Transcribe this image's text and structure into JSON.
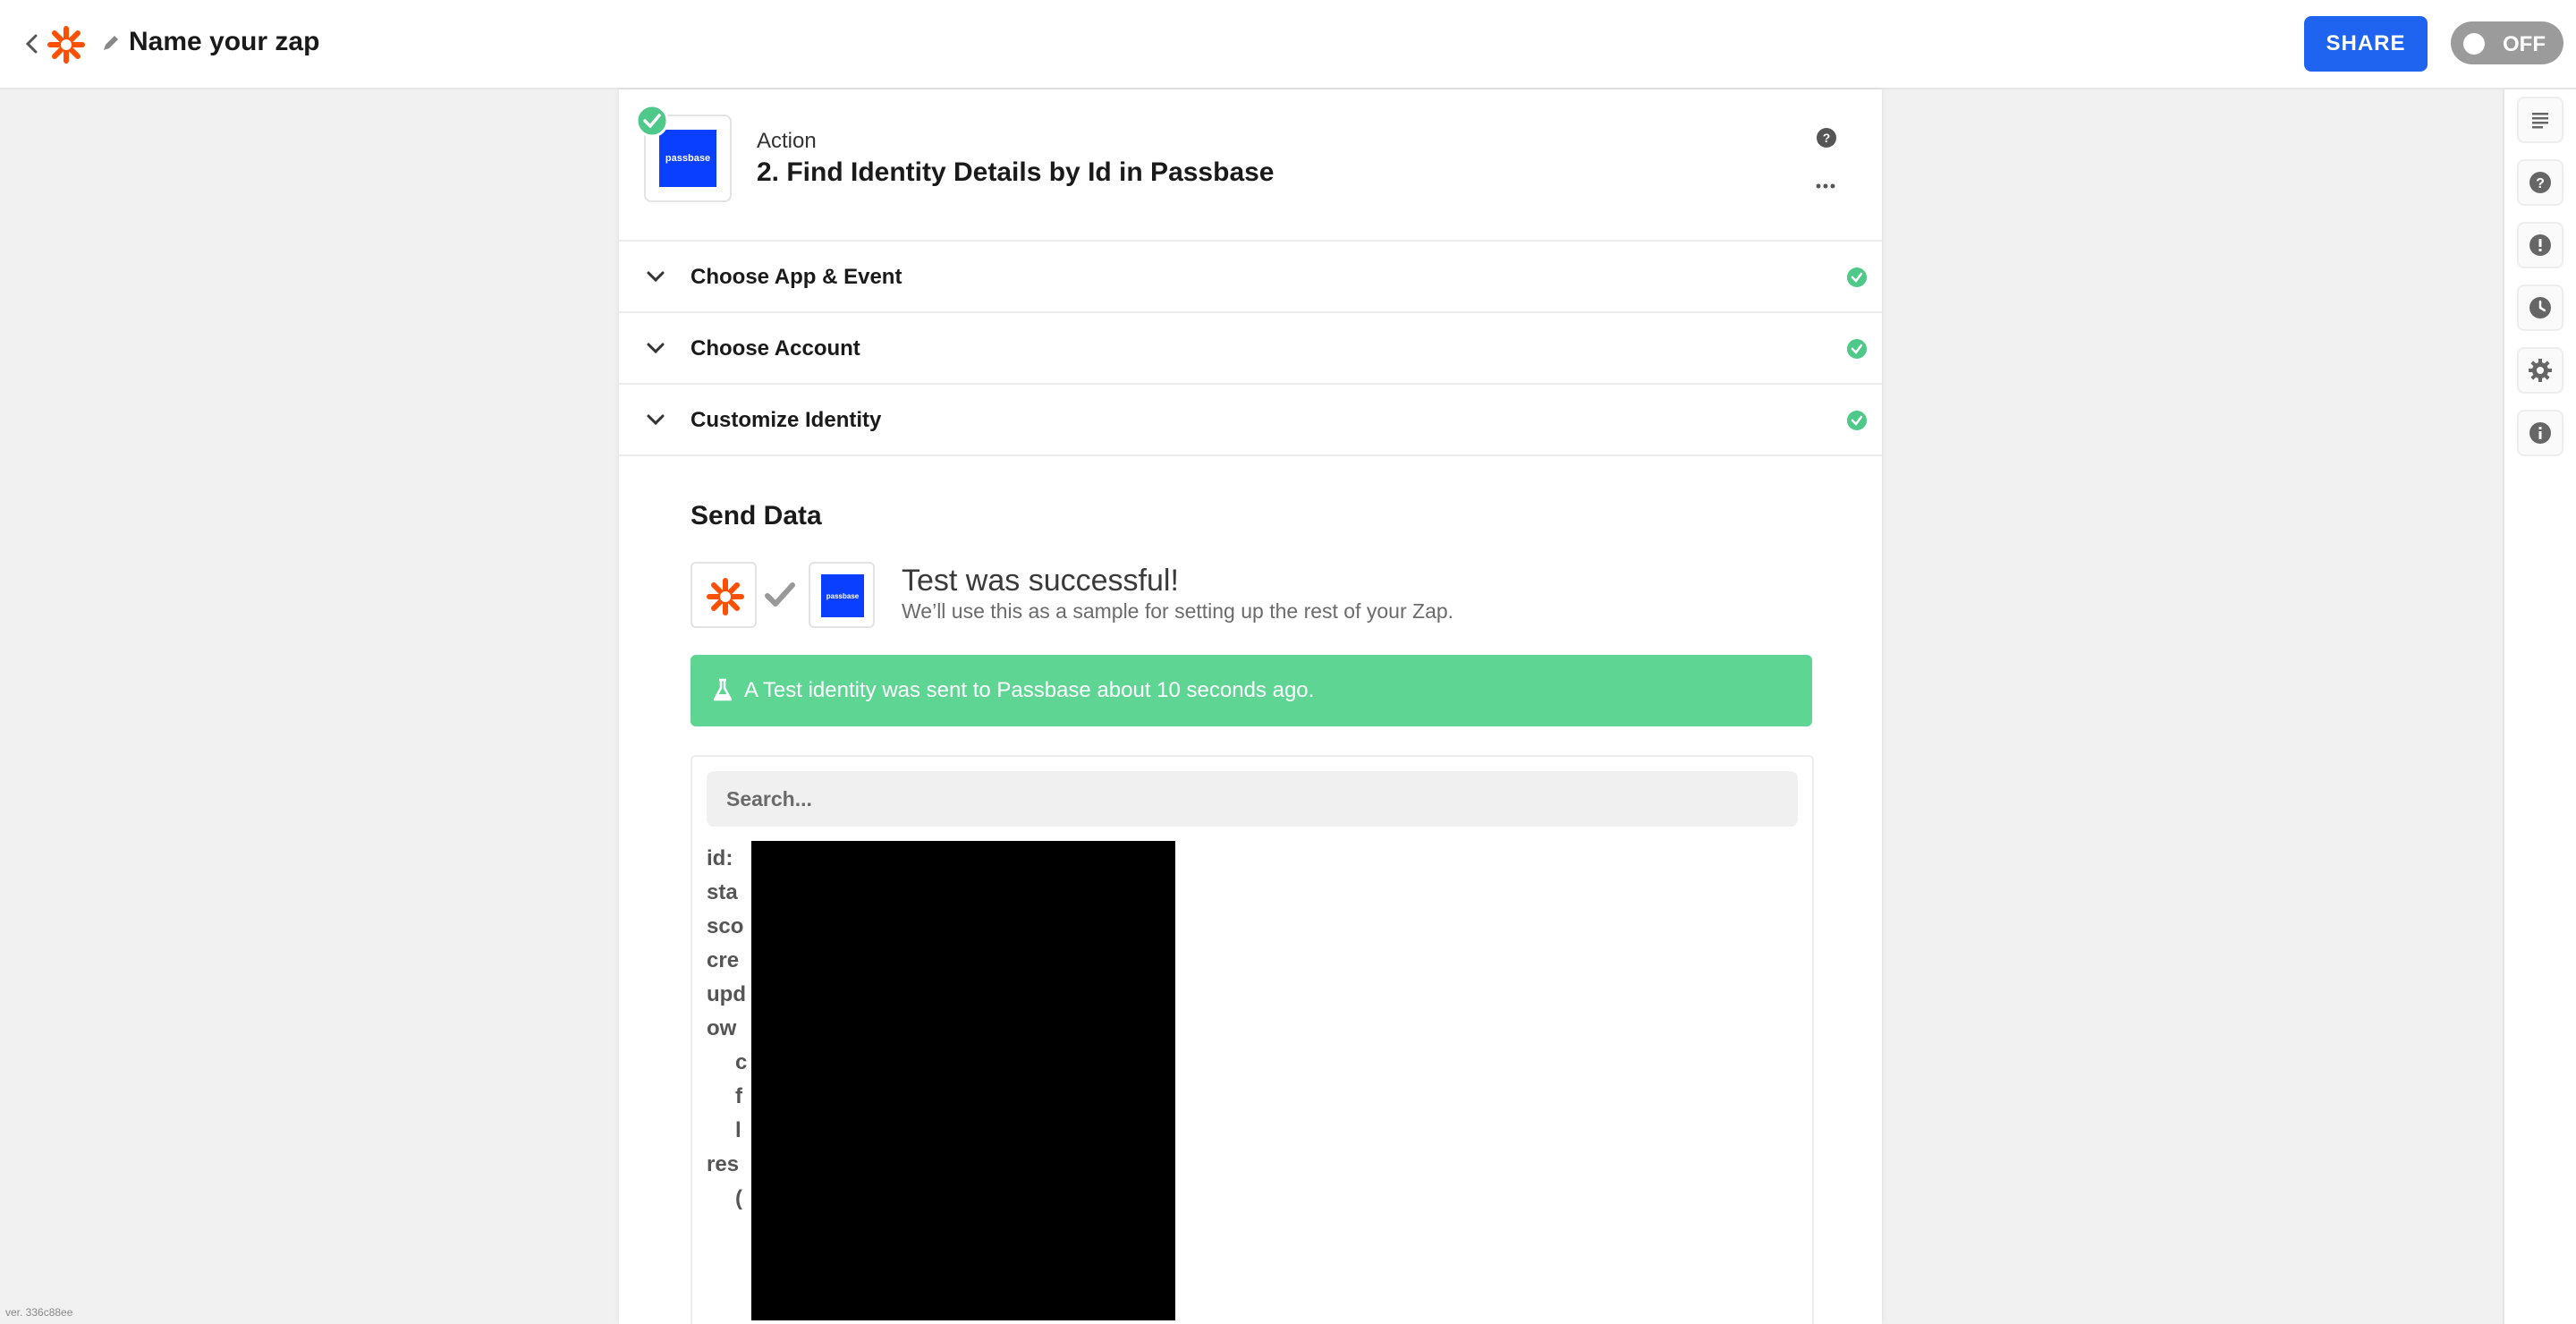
{
  "topbar": {
    "zap_name": "Name your zap",
    "share_label": "SHARE",
    "toggle_label": "OFF",
    "brand_color": "#ff4f00",
    "share_color": "#1e64f0"
  },
  "step": {
    "type_label": "Action",
    "title": "2. Find Identity Details by Id in Passbase",
    "app_logo_text": "passbase"
  },
  "sections": [
    {
      "label": "Choose App & Event"
    },
    {
      "label": "Choose Account"
    },
    {
      "label": "Customize Identity"
    }
  ],
  "send_data": {
    "title": "Send Data",
    "success_title": "Test was successful!",
    "success_subtitle": "We’ll use this as a sample for setting up the rest of your Zap.",
    "banner_text": "A Test identity was sent to Passbase about 10 seconds ago.",
    "banner_color": "#5ed592",
    "search_placeholder": "Search..."
  },
  "fields": [
    {
      "key": "id:"
    },
    {
      "key": "sta"
    },
    {
      "key": "sco"
    },
    {
      "key": "cre"
    },
    {
      "key": "upd"
    },
    {
      "key": "ow"
    },
    {
      "key": "c"
    },
    {
      "key": "f"
    },
    {
      "key": "l"
    },
    {
      "key": "res"
    },
    {
      "key": "("
    }
  ],
  "rail": {
    "icons": [
      "notes-icon",
      "help-icon",
      "alert-icon",
      "history-icon",
      "settings-icon",
      "info-icon"
    ]
  },
  "version": "ver. 336c88ee"
}
